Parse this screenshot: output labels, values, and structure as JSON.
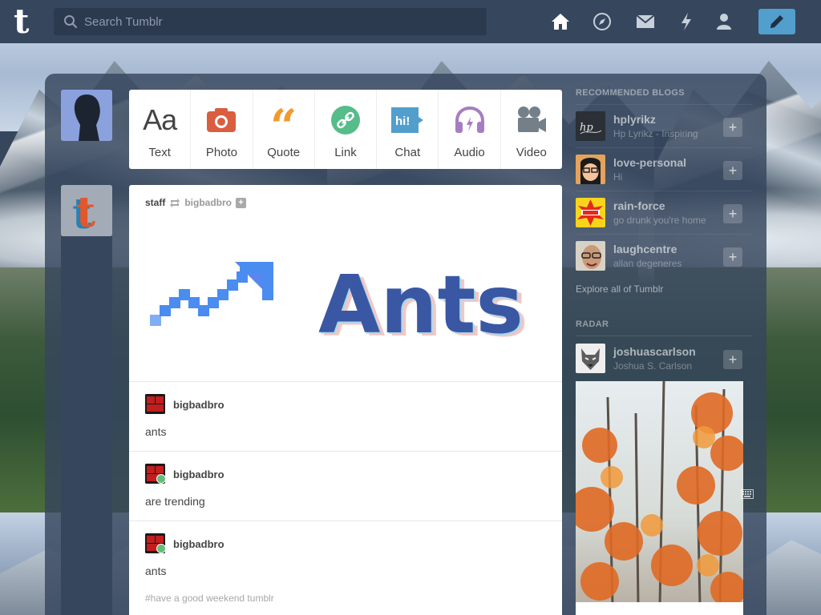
{
  "header": {
    "search_placeholder": "Search Tumblr",
    "nav_icons": [
      "home-icon",
      "explore-icon",
      "inbox-icon",
      "activity-icon",
      "account-icon"
    ],
    "compose_icon": "pencil-icon"
  },
  "post_types": [
    {
      "label": "Text",
      "icon": "text-icon",
      "color": "#444444"
    },
    {
      "label": "Photo",
      "icon": "camera-icon",
      "color": "#d95e40"
    },
    {
      "label": "Quote",
      "icon": "quote-icon",
      "color": "#f2992e"
    },
    {
      "label": "Link",
      "icon": "link-icon",
      "color": "#56bc8a"
    },
    {
      "label": "Chat",
      "icon": "chat-icon",
      "color": "#529ecc"
    },
    {
      "label": "Audio",
      "icon": "audio-icon",
      "color": "#a77dc2"
    },
    {
      "label": "Video",
      "icon": "video-icon",
      "color": "#748089"
    }
  ],
  "post": {
    "author": "staff",
    "reblogged_from": "bigbadbro",
    "image_text": "Ants",
    "replies": [
      {
        "user": "bigbadbro",
        "text": "ants"
      },
      {
        "user": "bigbadbro",
        "text": "are trending"
      },
      {
        "user": "bigbadbro",
        "text": "ants"
      }
    ],
    "tags": "#have a good weekend tumblr"
  },
  "sidebar": {
    "recommended_title": "RECOMMENDED BLOGS",
    "recommended": [
      {
        "name": "hplyrikz",
        "subtitle": "Hp Lyrikz - Inspiring"
      },
      {
        "name": "love-personal",
        "subtitle": "Hi"
      },
      {
        "name": "rain-force",
        "subtitle": "go drunk you're home"
      },
      {
        "name": "laughcentre",
        "subtitle": "allan degeneres"
      }
    ],
    "explore_link": "Explore all of Tumblr",
    "radar_title": "RADAR",
    "radar": {
      "name": "joshuascarlson",
      "subtitle": "Joshua S. Carlson"
    }
  },
  "colors": {
    "nav_bg": "#36465d",
    "compose_bg": "#529ecc",
    "search_bg": "#2c3a4f"
  }
}
